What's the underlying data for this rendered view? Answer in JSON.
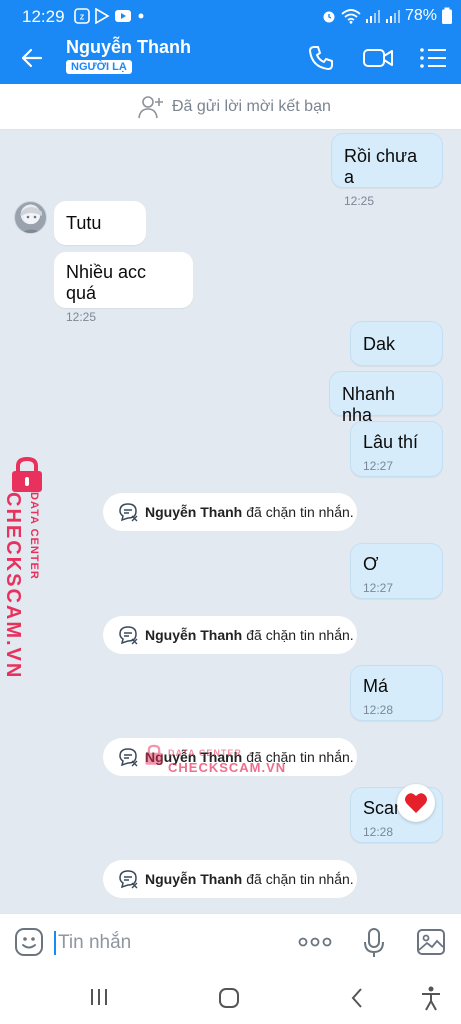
{
  "status_bar": {
    "time": "12:29",
    "battery": "78%",
    "left_icons": [
      "zalo-icon",
      "play-store-icon",
      "youtube-icon",
      "dot-icon"
    ],
    "right_icons": [
      "alarm-icon",
      "wifi-icon",
      "signal-icon",
      "signal-icon"
    ]
  },
  "header": {
    "name": "Nguyễn Thanh",
    "badge": "NGƯỜI LẠ",
    "accent_color": "#1a88f5"
  },
  "friend_bar": {
    "text": "Đã gửi lời mời kết bạn"
  },
  "messages": [
    {
      "side": "me",
      "text": "Rồi chưa a",
      "time": "12:25"
    },
    {
      "side": "them",
      "text": "Tutu",
      "time": ""
    },
    {
      "side": "them",
      "text": "Nhiều acc quá",
      "time": "12:25"
    },
    {
      "side": "me",
      "text": "Dak",
      "time": ""
    },
    {
      "side": "me",
      "text": "Nhanh nha",
      "time": ""
    },
    {
      "side": "me",
      "text": "Lâu thí",
      "time": "12:27"
    },
    {
      "side": "system",
      "name": "Nguyễn Thanh",
      "text": "đã chặn tin nhắn."
    },
    {
      "side": "me",
      "text": "Ơ",
      "time": "12:27"
    },
    {
      "side": "system",
      "name": "Nguyễn Thanh",
      "text": "đã chặn tin nhắn."
    },
    {
      "side": "me",
      "text": "Má",
      "time": "12:28"
    },
    {
      "side": "system",
      "name": "Nguyễn Thanh",
      "text": "đã chặn tin nhắn."
    },
    {
      "side": "me",
      "text": "Scam",
      "time": "12:28"
    },
    {
      "side": "system",
      "name": "Nguyễn Thanh",
      "text": "đã chặn tin nhắn."
    }
  ],
  "watermark": {
    "line1": "DATA CENTER",
    "line2": "CHECKSCAM.VN"
  },
  "input": {
    "placeholder": "Tin nhắn"
  }
}
